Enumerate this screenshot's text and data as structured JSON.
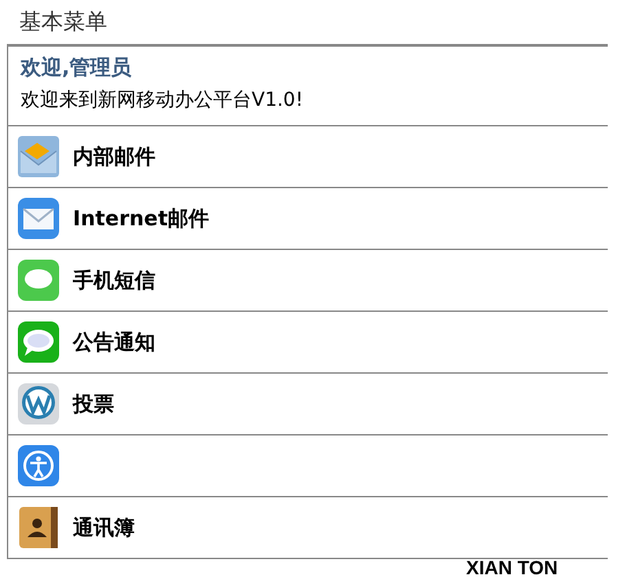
{
  "menu_title": "基本菜单",
  "welcome": {
    "greeting": "欢迎,管理员",
    "message": "欢迎来到新网移动办公平台V1.0!"
  },
  "items": [
    {
      "kind": "labeled",
      "label": "内部邮件"
    },
    {
      "kind": "labeled",
      "label": "Internet邮件"
    },
    {
      "kind": "labeled",
      "label": "手机短信"
    },
    {
      "kind": "labeled",
      "label": "公告通知"
    },
    {
      "kind": "labeled",
      "label": "投票"
    },
    {
      "kind": "icon_only"
    },
    {
      "kind": "labeled",
      "label": "通讯簿"
    }
  ],
  "footer": "XIAN TON"
}
